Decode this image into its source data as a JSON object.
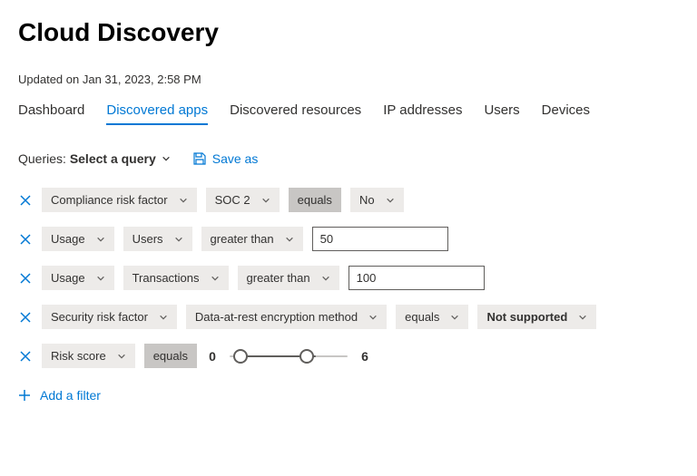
{
  "header": {
    "title": "Cloud Discovery",
    "updated": "Updated on Jan 31, 2023, 2:58 PM"
  },
  "tabs": [
    {
      "label": "Dashboard",
      "active": false
    },
    {
      "label": "Discovered apps",
      "active": true
    },
    {
      "label": "Discovered resources",
      "active": false
    },
    {
      "label": "IP addresses",
      "active": false
    },
    {
      "label": "Users",
      "active": false
    },
    {
      "label": "Devices",
      "active": false
    }
  ],
  "queries": {
    "label": "Queries:",
    "select": "Select a query",
    "save_as": "Save as"
  },
  "filters": [
    {
      "category": "Compliance risk factor",
      "sub": "SOC 2",
      "operator": "equals",
      "value_pill": "No",
      "value_input": null
    },
    {
      "category": "Usage",
      "sub": "Users",
      "operator": "greater than",
      "value_pill": null,
      "value_input": "50"
    },
    {
      "category": "Usage",
      "sub": "Transactions",
      "operator": "greater than",
      "value_pill": null,
      "value_input": "100"
    },
    {
      "category": "Security risk factor",
      "sub": "Data-at-rest encryption method",
      "operator": "equals",
      "value_pill": "Not supported",
      "value_input": null
    }
  ],
  "risk": {
    "category": "Risk score",
    "operator": "equals",
    "min": "0",
    "max": "6"
  },
  "add_filter": "Add a filter"
}
